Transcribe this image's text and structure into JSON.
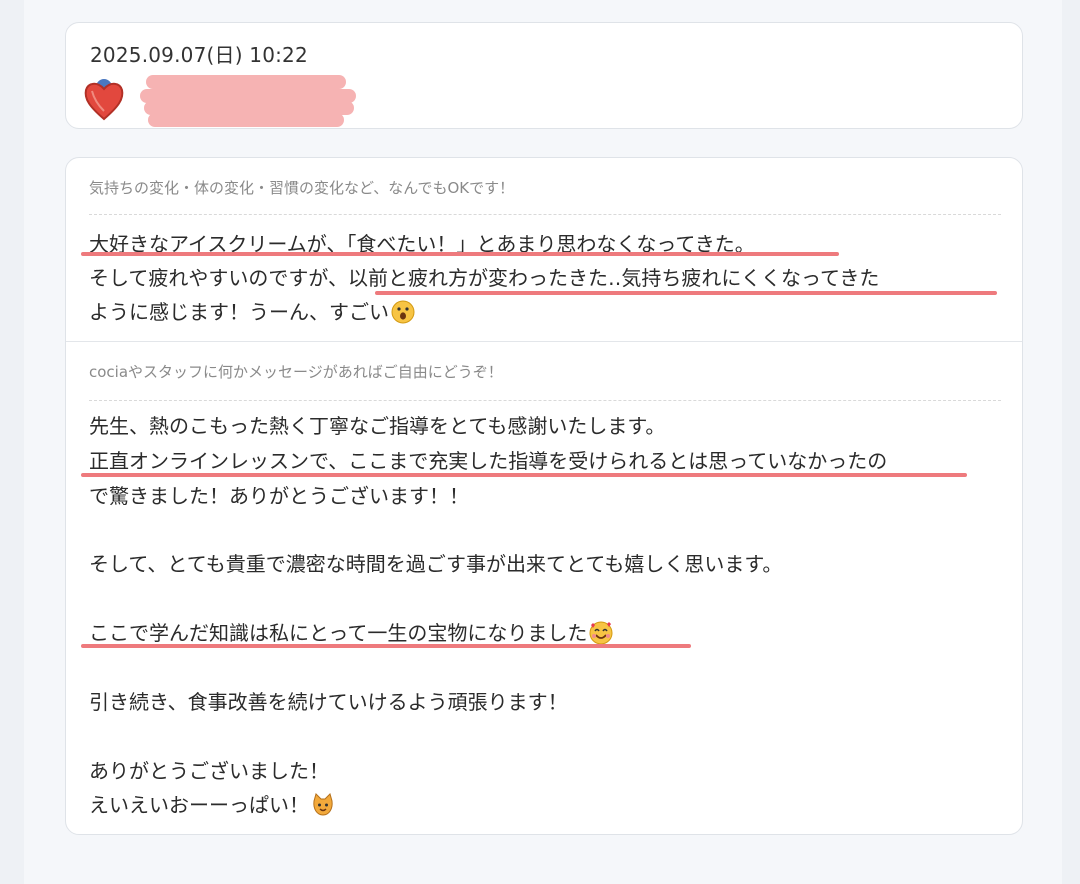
{
  "post": {
    "timestamp": "2025.09.07(日) 10:22"
  },
  "sections": [
    {
      "label": "気持ちの変化・体の変化・習慣の変化など、なんでもOKです！",
      "lines": [
        "大好きなアイスクリームが、「食べたい！」とあまり思わなくなってきた。",
        "そして疲れやすいのですが、以前と疲れ方が変わったきた‥気持ち疲れにくくなってきた",
        "ように感じます！うーん、すごい"
      ]
    },
    {
      "label": "cociaやスタッフに何かメッセージがあればご自由にどうぞ！",
      "lines": [
        "先生、熱のこもった熱く丁寧なご指導をとても感謝いたします。",
        "正直オンラインレッスンで、ここまで充実した指導を受けられるとは思っていなかったの",
        "で驚きました！ありがとうございます！！",
        "そして、とても貴重で濃密な時間を過ごす事が出来てとても嬉しく思います。",
        "ここで学んだ知識は私にとって一生の宝物になりました",
        "引き続き、食事改善を続けていけるよう頑張ります！",
        "ありがとうございました！",
        "えいえいおーーっぱい！"
      ]
    }
  ],
  "icons": {
    "avatar": "heart-avatar-icon",
    "emoji_wow": "surprised-face-icon",
    "emoji_love": "smiling-face-with-hearts-icon",
    "emoji_cat": "cat-face-icon"
  },
  "colors": {
    "underline": "#ee7a7d",
    "redaction": "#f6b3b3"
  }
}
